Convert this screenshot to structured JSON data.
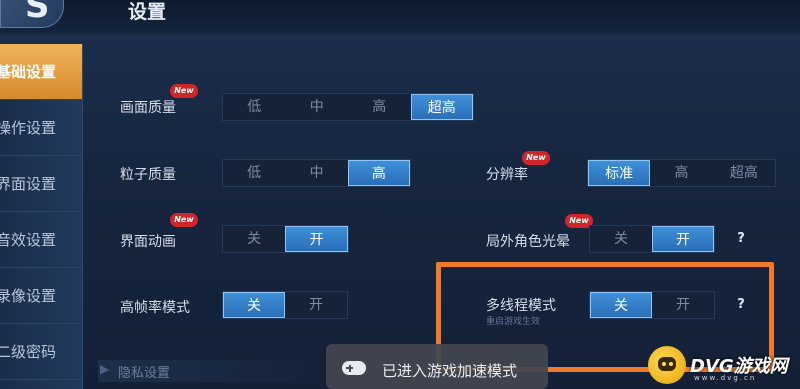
{
  "header": {
    "back_glyph": "S",
    "title": "设置"
  },
  "sidebar": {
    "items": [
      {
        "label": "基础设置",
        "active": true
      },
      {
        "label": "操作设置",
        "active": false
      },
      {
        "label": "界面设置",
        "active": false
      },
      {
        "label": "音效设置",
        "active": false
      },
      {
        "label": "录像设置",
        "active": false
      },
      {
        "label": "二级密码",
        "active": false
      }
    ]
  },
  "badge_text": "New",
  "settings": {
    "graphics_quality": {
      "label": "画面质量",
      "options": [
        "低",
        "中",
        "高",
        "超高"
      ],
      "selected": "超高",
      "new": true
    },
    "particle_quality": {
      "label": "粒子质量",
      "options": [
        "低",
        "中",
        "高"
      ],
      "selected": "高",
      "new": false
    },
    "resolution": {
      "label": "分辨率",
      "options": [
        "标准",
        "高",
        "超高"
      ],
      "selected": "标准",
      "new": true
    },
    "ui_animation": {
      "label": "界面动画",
      "options": [
        "关",
        "开"
      ],
      "selected": "开",
      "new": true
    },
    "outside_character_halo": {
      "label": "局外角色光晕",
      "options": [
        "关",
        "开"
      ],
      "selected": "开",
      "new": true,
      "help": "?"
    },
    "high_frame_rate": {
      "label": "高帧率模式",
      "options": [
        "关",
        "开"
      ],
      "selected": "关",
      "new": false
    },
    "multithread": {
      "label": "多线程模式",
      "note": "重启游戏生效",
      "options": [
        "关",
        "开"
      ],
      "selected": "关",
      "new": false,
      "help": "?"
    }
  },
  "bottom_row": {
    "label": "隐私设置"
  },
  "toast": {
    "text": "已进入游戏加速模式"
  },
  "watermark": {
    "text": "DVG游戏网",
    "url": "www.dvg.cn"
  },
  "colors": {
    "accent_tab": "#e9a046",
    "selected_option": "#3a86cf",
    "highlight_box": "#f07a26",
    "new_badge": "#d0262a"
  }
}
